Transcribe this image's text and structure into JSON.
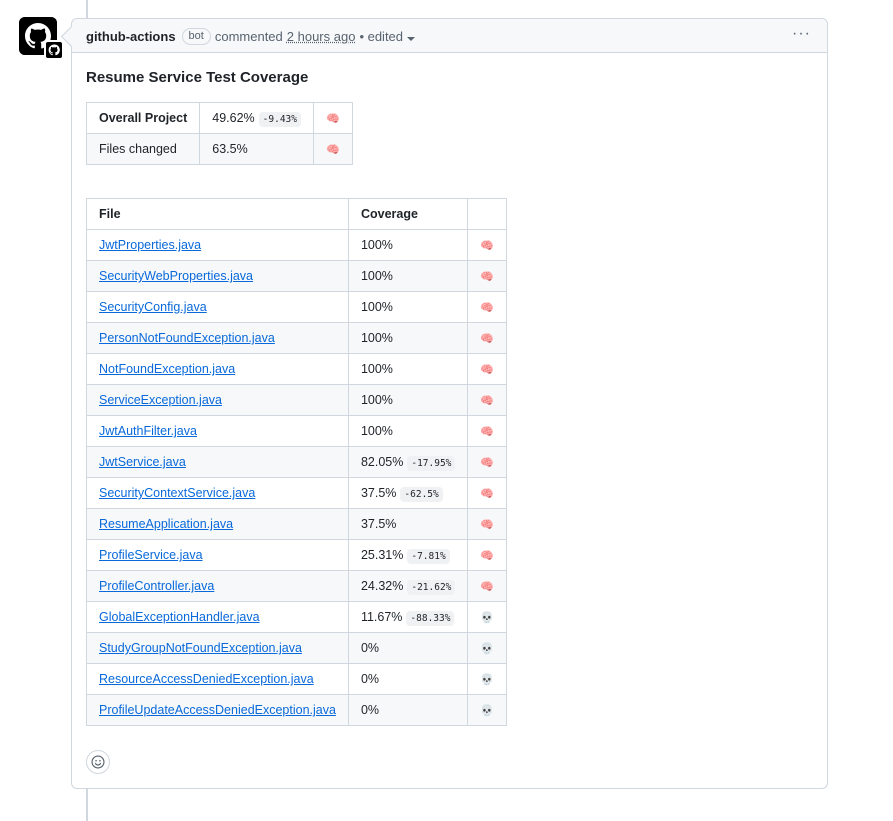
{
  "comment": {
    "author": "github-actions",
    "author_badge": "bot",
    "action": "commented",
    "timestamp": "2 hours ago",
    "edited": "• edited",
    "menu_icon": "kebab-horizontal-icon"
  },
  "report": {
    "title": "Resume Service Test Coverage",
    "summary": [
      {
        "label": "Overall Project",
        "value": "49.62%",
        "delta": "-9.43%",
        "icon": "brain"
      },
      {
        "label": "Files changed",
        "value": "63.5%",
        "delta": "",
        "icon": "brain"
      }
    ],
    "files_header": {
      "file": "File",
      "coverage": "Coverage",
      "icon": ""
    },
    "files": [
      {
        "name": "JwtProperties.java",
        "coverage": "100%",
        "delta": "",
        "icon": "brain"
      },
      {
        "name": "SecurityWebProperties.java",
        "coverage": "100%",
        "delta": "",
        "icon": "brain"
      },
      {
        "name": "SecurityConfig.java",
        "coverage": "100%",
        "delta": "",
        "icon": "brain"
      },
      {
        "name": "PersonNotFoundException.java",
        "coverage": "100%",
        "delta": "",
        "icon": "brain"
      },
      {
        "name": "NotFoundException.java",
        "coverage": "100%",
        "delta": "",
        "icon": "brain"
      },
      {
        "name": "ServiceException.java",
        "coverage": "100%",
        "delta": "",
        "icon": "brain"
      },
      {
        "name": "JwtAuthFilter.java",
        "coverage": "100%",
        "delta": "",
        "icon": "brain"
      },
      {
        "name": "JwtService.java",
        "coverage": "82.05%",
        "delta": "-17.95%",
        "icon": "brain"
      },
      {
        "name": "SecurityContextService.java",
        "coverage": "37.5%",
        "delta": "-62.5%",
        "icon": "brain"
      },
      {
        "name": "ResumeApplication.java",
        "coverage": "37.5%",
        "delta": "",
        "icon": "brain"
      },
      {
        "name": "ProfileService.java",
        "coverage": "25.31%",
        "delta": "-7.81%",
        "icon": "brain"
      },
      {
        "name": "ProfileController.java",
        "coverage": "24.32%",
        "delta": "-21.62%",
        "icon": "brain"
      },
      {
        "name": "GlobalExceptionHandler.java",
        "coverage": "11.67%",
        "delta": "-88.33%",
        "icon": "skull"
      },
      {
        "name": "StudyGroupNotFoundException.java",
        "coverage": "0%",
        "delta": "",
        "icon": "skull"
      },
      {
        "name": "ResourceAccessDeniedException.java",
        "coverage": "0%",
        "delta": "",
        "icon": "skull"
      },
      {
        "name": "ProfileUpdateAccessDeniedException.java",
        "coverage": "0%",
        "delta": "",
        "icon": "skull"
      }
    ]
  },
  "reaction": {
    "icon": "smiley-icon"
  }
}
